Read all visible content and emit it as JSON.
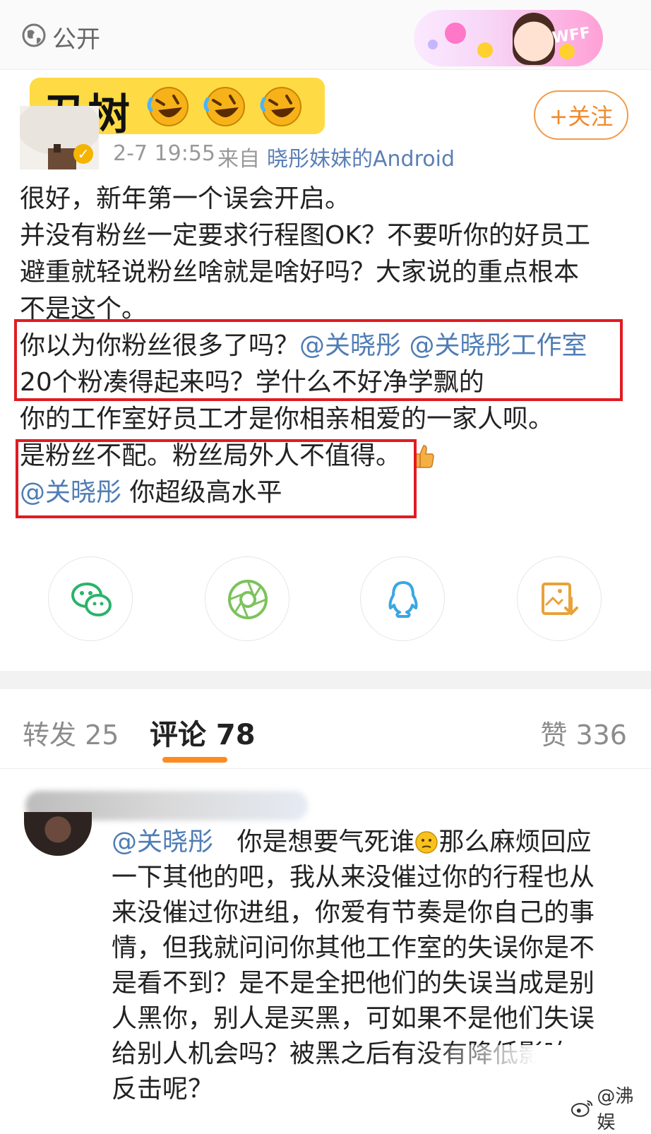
{
  "header": {
    "visibility": "公开",
    "banner_badge": "WFF"
  },
  "sticker": {
    "text": "丑树"
  },
  "post": {
    "follow_label": "+关注",
    "time": "2-7 19:55",
    "source_prefix": "来自",
    "source": "晓彤妹妹的Android",
    "lines": [
      "很好，新年第一个误会开启。",
      "并没有粉丝一定要求行程图OK？不要听你的好员工",
      "避重就轻说粉丝啥就是啥好吗？大家说的重点根本",
      "不是这个。",
      "你以为你粉丝很多了吗？",
      "@关晓彤 @关晓彤工作室",
      "20个粉凑得起来吗？学什么不好净学飘的",
      "你的工作室好员工才是你相亲相爱的一家人呗。",
      "是粉丝不配。粉丝局外人不值得。",
      "@关晓彤",
      "你超级高水平"
    ]
  },
  "share": {
    "icons": [
      "wechat-icon",
      "moments-icon",
      "qq-icon",
      "save-image-icon"
    ]
  },
  "tabs": {
    "reposts": "转发 25",
    "comments": "评论 78",
    "likes": "赞 336"
  },
  "comment": {
    "mention": "@关晓彤",
    "lines": [
      "你是想要气死谁",
      "那么麻烦回应",
      "一下其他的吧，我从来没催过你的行程也从",
      "来没催过你进组，你爱有节奏是你自己的事",
      "情，但我就问问你其他工作室的失误你是不",
      "是看不到？是不是全把他们的失误当成是别",
      "人黑你，别人是买黑，可如果不是他们失误",
      "给别人机会吗？被黑之后有没有降低影响",
      "反击呢？"
    ]
  },
  "watermark": {
    "text": "@沸娱"
  },
  "colors": {
    "mention": "#4f7db5",
    "highlight_box": "#e11b22",
    "sticker_bg": "#fedb45",
    "follow_accent": "#f08a2c",
    "tab_underline": "#ff8a1f"
  }
}
